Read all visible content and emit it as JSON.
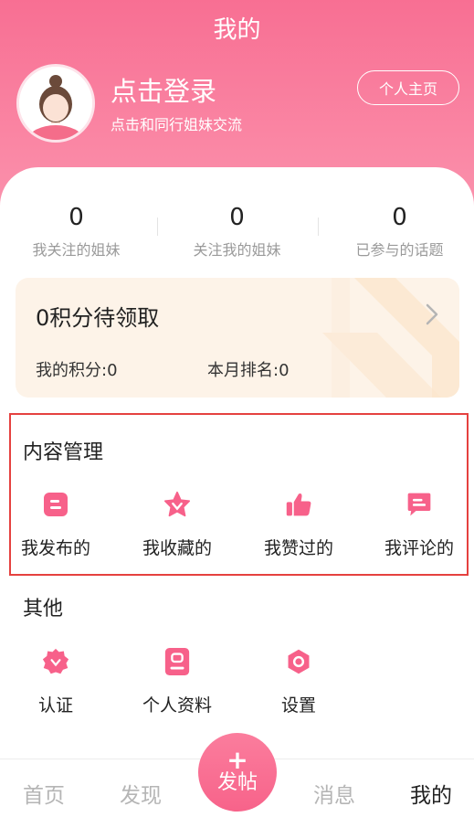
{
  "header": {
    "title": "我的",
    "login_title": "点击登录",
    "login_subtitle": "点击和同行姐妹交流",
    "profile_button": "个人主页",
    "bg_color": "#f86f93"
  },
  "stats": [
    {
      "value": "0",
      "label": "我关注的姐妹"
    },
    {
      "value": "0",
      "label": "关注我的姐妹"
    },
    {
      "value": "0",
      "label": "已参与的话题"
    }
  ],
  "points": {
    "title": "0积分待领取",
    "my_points": "我的积分:0",
    "monthly_rank": "本月排名:0"
  },
  "content_management": {
    "title": "内容管理",
    "items": [
      {
        "label": "我发布的",
        "icon": "document-icon"
      },
      {
        "label": "我收藏的",
        "icon": "star-icon"
      },
      {
        "label": "我赞过的",
        "icon": "thumbs-up-icon"
      },
      {
        "label": "我评论的",
        "icon": "comment-icon"
      }
    ]
  },
  "other": {
    "title": "其他",
    "items": [
      {
        "label": "认证",
        "icon": "badge-icon"
      },
      {
        "label": "个人资料",
        "icon": "profile-card-icon"
      },
      {
        "label": "设置",
        "icon": "settings-icon"
      }
    ]
  },
  "nav": {
    "home": "首页",
    "discover": "发现",
    "post_plus": "+",
    "post": "发帖",
    "messages": "消息",
    "mine": "我的"
  },
  "colors": {
    "accent": "#f86f93",
    "highlight_border": "#e5413f"
  }
}
